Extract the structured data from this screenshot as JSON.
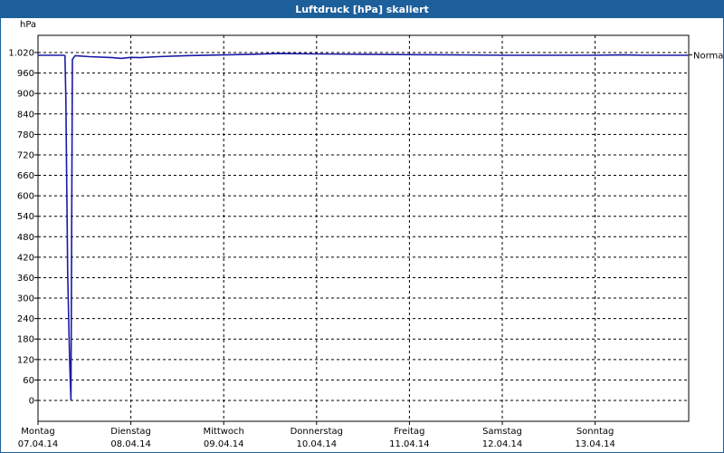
{
  "window": {
    "title": "Luftdruck [hPa] skaliert"
  },
  "chart_data": {
    "type": "line",
    "title": "Luftdruck [hPa] skaliert",
    "ylabel": "hPa",
    "ylim": [
      0,
      1020
    ],
    "yticks": [
      "1.020",
      "960",
      "900",
      "840",
      "780",
      "720",
      "660",
      "600",
      "540",
      "480",
      "420",
      "360",
      "300",
      "240",
      "180",
      "120",
      "60",
      "0"
    ],
    "ytick_values": [
      1020,
      960,
      900,
      840,
      780,
      720,
      660,
      600,
      540,
      480,
      420,
      360,
      300,
      240,
      180,
      120,
      60,
      0
    ],
    "xlim": [
      0,
      7
    ],
    "xticks": [
      {
        "day": "Montag",
        "date": "07.04.14",
        "x": 0
      },
      {
        "day": "Dienstag",
        "date": "08.04.14",
        "x": 1
      },
      {
        "day": "Mittwoch",
        "date": "09.04.14",
        "x": 2
      },
      {
        "day": "Donnerstag",
        "date": "10.04.14",
        "x": 3
      },
      {
        "day": "Freitag",
        "date": "11.04.14",
        "x": 4
      },
      {
        "day": "Samstag",
        "date": "12.04.14",
        "x": 5
      },
      {
        "day": "Sonntag",
        "date": "13.04.14",
        "x": 6
      }
    ],
    "grid": true,
    "reference_line": {
      "label": "Normal",
      "value": 1013
    },
    "series": [
      {
        "color": "#1a1aa6",
        "points": [
          [
            0.0,
            1012
          ],
          [
            0.28,
            1012
          ],
          [
            0.29,
            1011
          ],
          [
            0.3,
            880
          ],
          [
            0.31,
            620
          ],
          [
            0.32,
            370
          ],
          [
            0.34,
            120
          ],
          [
            0.355,
            0
          ],
          [
            0.37,
            1000
          ],
          [
            0.4,
            1011
          ],
          [
            0.55,
            1008
          ],
          [
            0.8,
            1005
          ],
          [
            0.9,
            1003
          ],
          [
            1.0,
            1006
          ],
          [
            1.1,
            1005
          ],
          [
            1.3,
            1008
          ],
          [
            1.6,
            1011
          ],
          [
            2.0,
            1013
          ],
          [
            2.3,
            1015
          ],
          [
            2.6,
            1017
          ],
          [
            3.0,
            1016
          ],
          [
            3.5,
            1015
          ],
          [
            4.0,
            1014
          ],
          [
            4.5,
            1013
          ],
          [
            5.0,
            1012
          ],
          [
            5.5,
            1012
          ],
          [
            6.0,
            1012
          ],
          [
            6.3,
            1013
          ],
          [
            6.5,
            1012
          ],
          [
            7.0,
            1012
          ]
        ]
      }
    ]
  },
  "colors": {
    "titlebar": "#1d5f9a",
    "line": "#1a1aa6",
    "grid": "#000000"
  }
}
